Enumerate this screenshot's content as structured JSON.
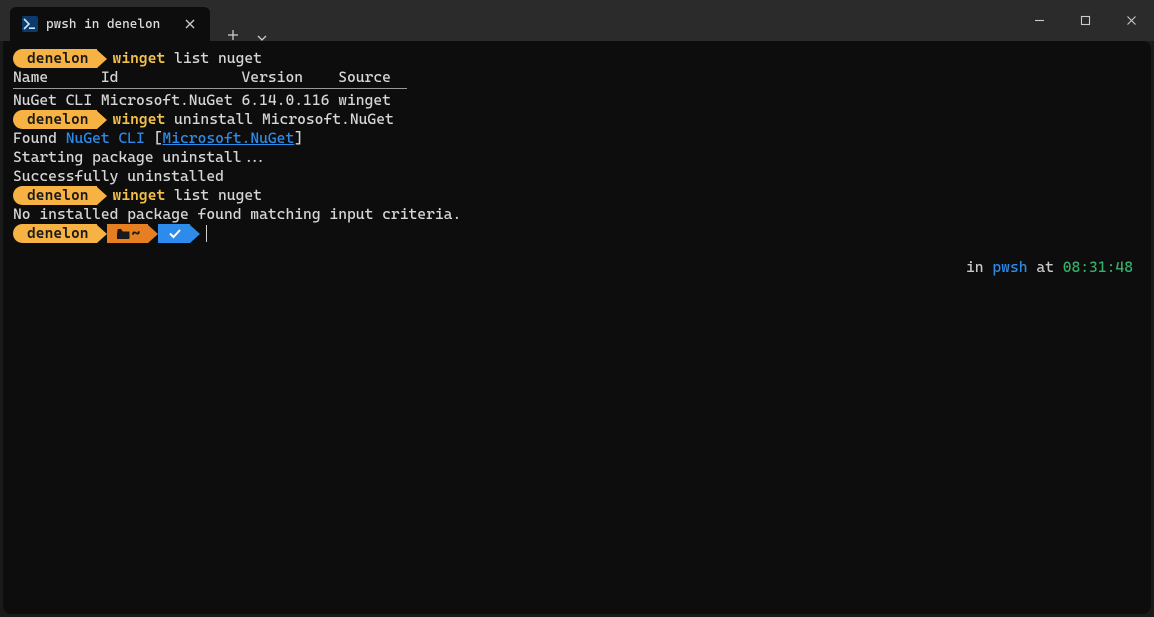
{
  "titlebar": {
    "tab_title": "pwsh in denelon",
    "tab_icon_glyph": ">_"
  },
  "prompt": {
    "user": "denelon",
    "folder_glyph": "~",
    "status_icon": "check"
  },
  "lines": {
    "cmd1_winget": "winget",
    "cmd1_rest": " list nuget",
    "header": "Name      Id              Version    Source",
    "row1": "NuGet CLI Microsoft.NuGet 6.14.0.116 winget",
    "cmd2_winget": "winget",
    "cmd2_rest": " uninstall Microsoft.NuGet",
    "found_prefix": "Found ",
    "found_name": "NuGet CLI",
    "found_open": " [",
    "found_id": "Microsoft.NuGet",
    "found_close": "]",
    "starting": "Starting package uninstall...",
    "success": "Successfully uninstalled",
    "cmd3_winget": "winget",
    "cmd3_rest": " list nuget",
    "nomatch": "No installed package found matching input criteria."
  },
  "right_status": {
    "in": "in ",
    "shell": "pwsh",
    "at": " at ",
    "time": "08:31:48"
  }
}
